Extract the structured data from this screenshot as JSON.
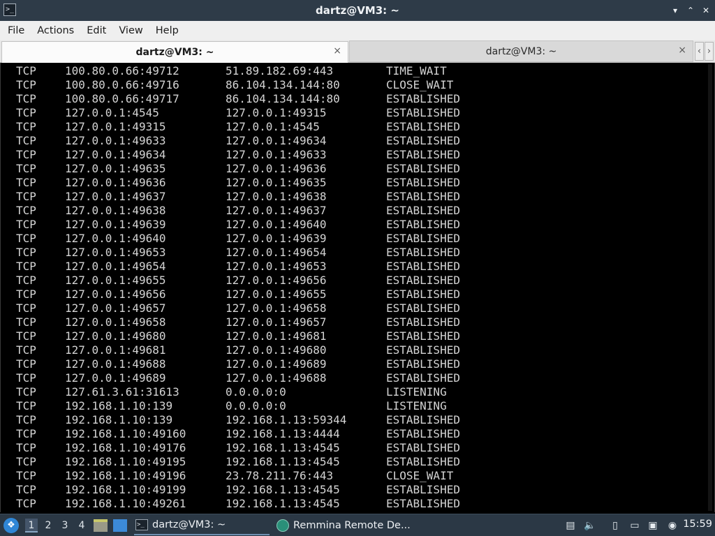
{
  "window": {
    "title": "dartz@VM3: ~",
    "minimize": "▾",
    "maximize": "⌃",
    "close": "✕"
  },
  "menu": [
    "File",
    "Actions",
    "Edit",
    "View",
    "Help"
  ],
  "tabs": [
    {
      "label": "dartz@VM3: ~",
      "close": "×",
      "active": true
    },
    {
      "label": "dartz@VM3: ~",
      "close": "×",
      "active": false
    }
  ],
  "tabnav": {
    "left": "‹",
    "right": "›"
  },
  "terminal": {
    "rows": [
      [
        "TCP",
        "100.80.0.66:49712",
        "51.89.182.69:443",
        "TIME_WAIT"
      ],
      [
        "TCP",
        "100.80.0.66:49716",
        "86.104.134.144:80",
        "CLOSE_WAIT"
      ],
      [
        "TCP",
        "100.80.0.66:49717",
        "86.104.134.144:80",
        "ESTABLISHED"
      ],
      [
        "TCP",
        "127.0.0.1:4545",
        "127.0.0.1:49315",
        "ESTABLISHED"
      ],
      [
        "TCP",
        "127.0.0.1:49315",
        "127.0.0.1:4545",
        "ESTABLISHED"
      ],
      [
        "TCP",
        "127.0.0.1:49633",
        "127.0.0.1:49634",
        "ESTABLISHED"
      ],
      [
        "TCP",
        "127.0.0.1:49634",
        "127.0.0.1:49633",
        "ESTABLISHED"
      ],
      [
        "TCP",
        "127.0.0.1:49635",
        "127.0.0.1:49636",
        "ESTABLISHED"
      ],
      [
        "TCP",
        "127.0.0.1:49636",
        "127.0.0.1:49635",
        "ESTABLISHED"
      ],
      [
        "TCP",
        "127.0.0.1:49637",
        "127.0.0.1:49638",
        "ESTABLISHED"
      ],
      [
        "TCP",
        "127.0.0.1:49638",
        "127.0.0.1:49637",
        "ESTABLISHED"
      ],
      [
        "TCP",
        "127.0.0.1:49639",
        "127.0.0.1:49640",
        "ESTABLISHED"
      ],
      [
        "TCP",
        "127.0.0.1:49640",
        "127.0.0.1:49639",
        "ESTABLISHED"
      ],
      [
        "TCP",
        "127.0.0.1:49653",
        "127.0.0.1:49654",
        "ESTABLISHED"
      ],
      [
        "TCP",
        "127.0.0.1:49654",
        "127.0.0.1:49653",
        "ESTABLISHED"
      ],
      [
        "TCP",
        "127.0.0.1:49655",
        "127.0.0.1:49656",
        "ESTABLISHED"
      ],
      [
        "TCP",
        "127.0.0.1:49656",
        "127.0.0.1:49655",
        "ESTABLISHED"
      ],
      [
        "TCP",
        "127.0.0.1:49657",
        "127.0.0.1:49658",
        "ESTABLISHED"
      ],
      [
        "TCP",
        "127.0.0.1:49658",
        "127.0.0.1:49657",
        "ESTABLISHED"
      ],
      [
        "TCP",
        "127.0.0.1:49680",
        "127.0.0.1:49681",
        "ESTABLISHED"
      ],
      [
        "TCP",
        "127.0.0.1:49681",
        "127.0.0.1:49680",
        "ESTABLISHED"
      ],
      [
        "TCP",
        "127.0.0.1:49688",
        "127.0.0.1:49689",
        "ESTABLISHED"
      ],
      [
        "TCP",
        "127.0.0.1:49689",
        "127.0.0.1:49688",
        "ESTABLISHED"
      ],
      [
        "TCP",
        "127.61.3.61:31613",
        "0.0.0.0:0",
        "LISTENING"
      ],
      [
        "TCP",
        "192.168.1.10:139",
        "0.0.0.0:0",
        "LISTENING"
      ],
      [
        "TCP",
        "192.168.1.10:139",
        "192.168.1.13:59344",
        "ESTABLISHED"
      ],
      [
        "TCP",
        "192.168.1.10:49160",
        "192.168.1.13:4444",
        "ESTABLISHED"
      ],
      [
        "TCP",
        "192.168.1.10:49176",
        "192.168.1.13:4545",
        "ESTABLISHED"
      ],
      [
        "TCP",
        "192.168.1.10:49195",
        "192.168.1.13:4545",
        "ESTABLISHED"
      ],
      [
        "TCP",
        "192.168.1.10:49196",
        "23.78.211.76:443",
        "CLOSE_WAIT"
      ],
      [
        "TCP",
        "192.168.1.10:49199",
        "192.168.1.13:4545",
        "ESTABLISHED"
      ],
      [
        "TCP",
        "192.168.1.10:49261",
        "192.168.1.13:4545",
        "ESTABLISHED"
      ]
    ]
  },
  "taskbar": {
    "workspaces": [
      "1",
      "2",
      "3",
      "4"
    ],
    "active_workspace": "1",
    "tasks": [
      {
        "label": "dartz@VM3: ~",
        "icon": "terminal-icon"
      },
      {
        "label": "Remmina Remote De...",
        "icon": "remmina-icon"
      }
    ],
    "clock": "15:59"
  },
  "colors": {
    "titlebar": "#2e3b48",
    "terminal_bg": "#000000",
    "terminal_fg": "#d4d4d4",
    "taskbar": "#2b3845"
  }
}
